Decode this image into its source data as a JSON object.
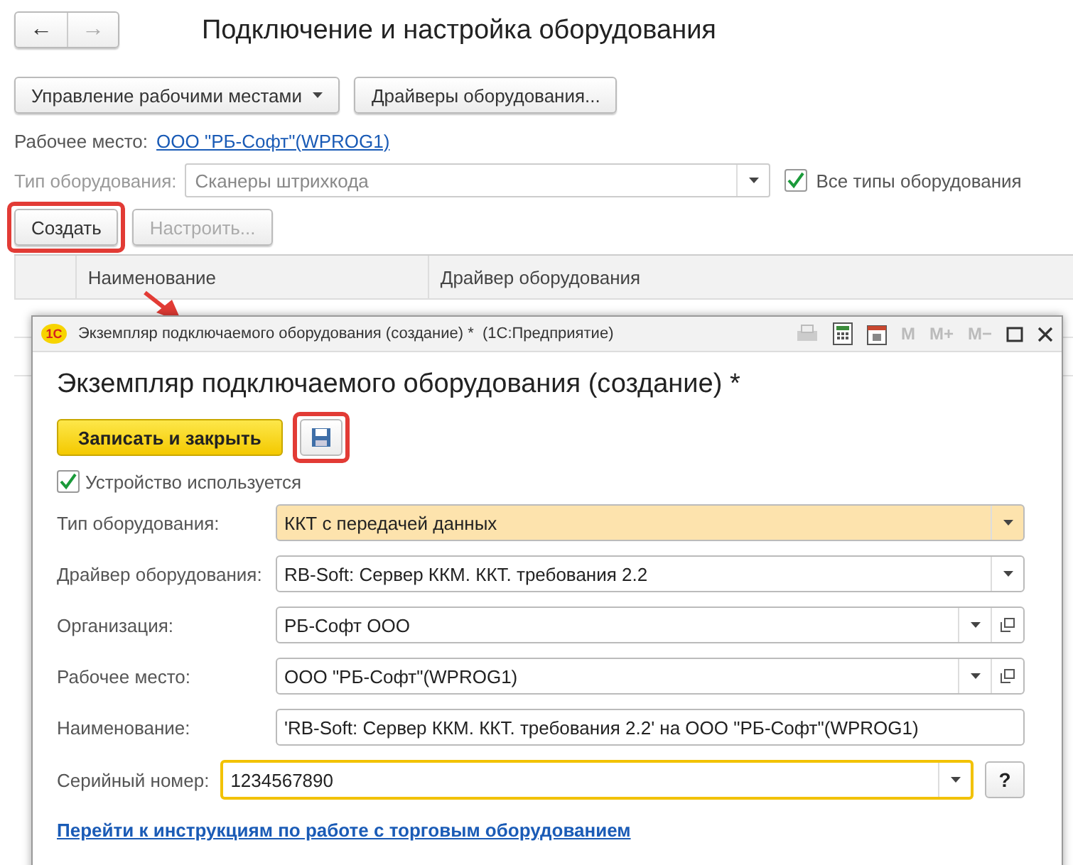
{
  "nav": [
    {
      "glyph": "←",
      "disabled": false
    },
    {
      "glyph": "→",
      "disabled": true
    }
  ],
  "page_title": "Подключение и настройка оборудования",
  "toolbar": [
    {
      "label": "Управление рабочими местами",
      "kind": "dropdown"
    },
    {
      "label": "Драйверы оборудования...",
      "kind": "plain"
    }
  ],
  "workplace": {
    "label": "Рабочее место:",
    "link": "ООО \"РБ-Софт\"(WPROG1)"
  },
  "equipment_type": {
    "label": "Тип оборудования:",
    "value": "Сканеры штрихкода",
    "disabled": true
  },
  "all_types": {
    "label": "Все типы оборудования",
    "checked": true
  },
  "actions": [
    {
      "label": "Создать",
      "disabled": false,
      "highlighted": true
    },
    {
      "label": "Настроить...",
      "disabled": true,
      "highlighted": false
    }
  ],
  "table": {
    "columns": [
      "Наименование",
      "Драйвер оборудования"
    ]
  },
  "dialog": {
    "logo": "1С",
    "window_title": "Экземпляр подключаемого оборудования (создание) *  (1С:Предприятие)",
    "memory_buttons": [
      "M",
      "M+",
      "M−"
    ],
    "heading": "Экземпляр подключаемого оборудования (создание) *",
    "save_close": "Записать и закрыть",
    "save_highlighted": true,
    "in_use": {
      "label": "Устройство используется",
      "checked": true
    },
    "fields": [
      {
        "label": "Тип оборудования:",
        "value": "ККТ с передачей данных",
        "kind": "select",
        "highlighted": true,
        "focused": false
      },
      {
        "label": "Драйвер оборудования:",
        "value": "RB-Soft: Сервер ККМ. ККТ. требования 2.2",
        "kind": "select",
        "highlighted": false,
        "focused": false
      },
      {
        "label": "Организация:",
        "value": "РБ-Софт ООО",
        "kind": "select_open",
        "highlighted": false,
        "focused": false
      },
      {
        "label": "Рабочее место:",
        "value": "ООО \"РБ-Софт\"(WPROG1)",
        "kind": "select_open",
        "highlighted": false,
        "focused": false
      },
      {
        "label": "Наименование:",
        "value": "'RB-Soft: Сервер ККМ. ККТ. требования 2.2' на ООО \"РБ-Софт\"(WPROG1)",
        "kind": "text",
        "highlighted": false,
        "focused": false
      },
      {
        "label": "Серийный номер:",
        "value": "1234567890",
        "kind": "select",
        "highlighted": false,
        "focused": true,
        "help": "?"
      }
    ],
    "link": "Перейти к инструкциям по работе с торговым оборудованием"
  }
}
